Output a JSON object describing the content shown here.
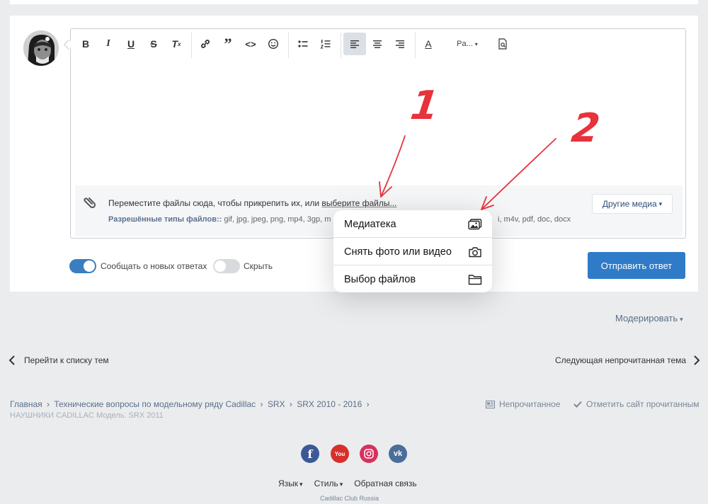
{
  "composer": {
    "toolbar": {
      "bold": "B",
      "italic": "I",
      "underline": "U",
      "strike": "S",
      "clear_format": "T",
      "clear_format_sub": "x",
      "quote": "”",
      "code": "<>",
      "paragraph": "Pa...",
      "paragraph_caret": "▾",
      "color_letter": "A"
    },
    "attach": {
      "text_prefix": "Переместите файлы сюда, чтобы прикрепить их, или ",
      "link": "выберите файлы...",
      "types_label": "Разрешённые типы файлов::",
      "types_visible": " gif, jpg, jpeg, png, mp4, 3gp, m",
      "types_tail": "i, m4v, pdf, doc, docx"
    },
    "other_media": "Другие медиа",
    "other_media_caret": "▾",
    "notify_label": "Сообщать о новых ответах",
    "hide_label": "Скрыть",
    "submit": "Отправить ответ"
  },
  "annotations": {
    "one": "1",
    "two": "2"
  },
  "popover": {
    "items": [
      {
        "label": "Медиатека",
        "icon": "photo-library-icon"
      },
      {
        "label": "Снять фото или видео",
        "icon": "camera-icon"
      },
      {
        "label": "Выбор файлов",
        "icon": "folder-icon"
      }
    ]
  },
  "page": {
    "moderate": "Модерировать",
    "moderate_caret": "▾",
    "prev_topics": "Перейти к списку тем",
    "next_unread": "Следующая непрочитанная тема",
    "breadcrumb": [
      "Главная",
      "Технические вопросы по модельному ряду Cadillac",
      "SRX",
      "SRX 2010 - 2016"
    ],
    "breadcrumb_sep": "›",
    "current_topic": "НАУШНИКИ CADILLAC Модель: SRX 2011",
    "unread": "Непрочитанное",
    "mark_read": "Отметить сайт прочитанным"
  },
  "footer": {
    "social": [
      "facebook-icon",
      "youtube-icon",
      "instagram-icon",
      "vk-icon"
    ],
    "social_text": {
      "facebook": "f",
      "youtube": "You",
      "vk": "vk"
    },
    "language": "Язык",
    "style": "Стиль",
    "caret": "▾",
    "feedback": "Обратная связь",
    "copyright": "Cadillac Club Russia"
  },
  "colors": {
    "accent": "#2f7bc8",
    "annotation_red": "#e8323c",
    "facebook": "#3b5998",
    "youtube": "#d7302b",
    "instagram": "#d8305c",
    "vk": "#4a6e9a"
  }
}
